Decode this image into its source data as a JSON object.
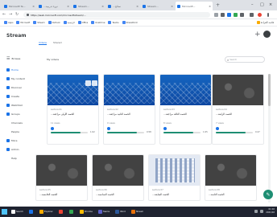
{
  "browser": {
    "tabs": [
      {
        "label": "Microsoft Te..."
      },
      {
        "label": "...دورة تدريبية"
      },
      {
        "label": "Stream..."
      },
      {
        "label": "...نصائح"
      },
      {
        "label": "Stream..."
      },
      {
        "label": "Microsoft..."
      }
    ],
    "new_tab": "+",
    "window_controls": [
      "–",
      "□",
      "×"
    ],
    "url": "https://web.microsoft.com/microsoftstream/...",
    "bookmarks": [
      {
        "label": "Apps"
      },
      {
        "label": "Microsoft"
      },
      {
        "label": "Stream"
      },
      {
        "label": "Outlook"
      },
      {
        "label": "الرئيسية"
      },
      {
        "label": "Office"
      },
      {
        "label": "OneDrive"
      },
      {
        "label": "Teams"
      },
      {
        "label": "SharePoint"
      }
    ],
    "bookmarks_other": "قائمة القراءة"
  },
  "app": {
    "name": "Stream",
    "subnav": [
      {
        "label": "Videos"
      },
      {
        "label": "Shared"
      }
    ],
    "menu_label": "Browse",
    "nav": [
      {
        "label": "Home"
      },
      {
        "label": "My content"
      },
      {
        "label": "Discover"
      },
      {
        "label": "Create"
      },
      {
        "label": "Watchlist"
      },
      {
        "label": "Groups"
      },
      {
        "label": "Channels"
      },
      {
        "label": "People"
      },
      {
        "label": "More"
      },
      {
        "label": "Admin"
      },
      {
        "label": "Help"
      }
    ],
    "main_title": "My videos",
    "search_placeholder": "Search"
  },
  "cards": [
    {
      "title": "...الحصة الأولى مراجعة",
      "meta": "Lecture 01",
      "info": "11 views",
      "time": "1:02",
      "progress": 0.8
    },
    {
      "title": "...الحصة الثانية مراجعة",
      "meta": "Lecture 02",
      "info": "9 views",
      "time": "0:58",
      "progress": 0.8
    },
    {
      "title": "...الحصة الثالثة مراجعة",
      "meta": "Lecture 03",
      "info": "8 views",
      "time": "1:05",
      "progress": 0.8
    },
    {
      "title": "...الحصة الرابعة",
      "meta": "Lecture 04",
      "info": "7 views",
      "time": "0:47",
      "progress": 0.8
    },
    {
      "title": "...الحصة الخامسة",
      "meta": "Lecture 05"
    },
    {
      "title": "...الحصة السادسة",
      "meta": "Lecture 06"
    },
    {
      "title": "...الحصة السابعة",
      "meta": "Lecture 07"
    },
    {
      "title": "...الحصة الثامنة",
      "meta": "Lecture 08"
    }
  ],
  "taskbar": {
    "items": [
      {
        "label": "Search",
        "color": "#ffffff"
      },
      {
        "label": "",
        "color": "#1a73e8"
      },
      {
        "label": "Explorer",
        "color": "#f9ab00"
      },
      {
        "label": "",
        "color": "#ea4335"
      },
      {
        "label": "",
        "color": "#34a853"
      },
      {
        "label": "Chrome",
        "color": "#fbbc04"
      },
      {
        "label": "Teams",
        "color": "#5b5fc7"
      },
      {
        "label": "Word",
        "color": "#2b579a"
      },
      {
        "label": "Stream",
        "color": "#e8710a"
      }
    ],
    "clock_time": "01:02",
    "clock_date": "2021/02"
  },
  "colors": {
    "accent": "#1a73e8",
    "progress": "#1e8e73",
    "fab": "#1e8e73"
  }
}
